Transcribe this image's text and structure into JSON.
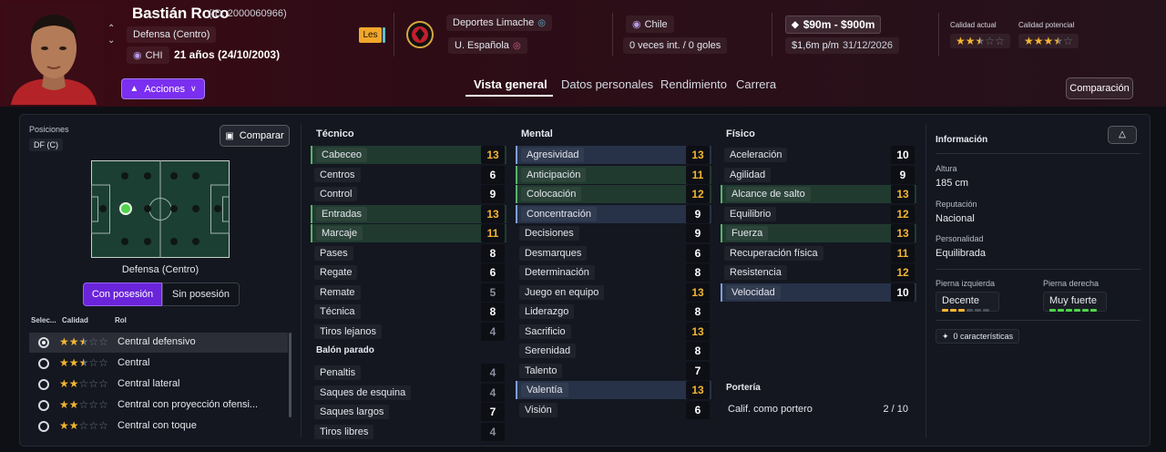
{
  "player": {
    "name": "Bastián Roco",
    "id_text": "(ID: 2000060966)",
    "position": "Defensa (Centro)",
    "nationality_code": "CHI",
    "age_text": "21 años (24/10/2003)",
    "injury_badge": "Les",
    "club": "Deportes Limache",
    "league": "U. Española",
    "country": "Chile",
    "caps_goals": "0 veces int. / 0 goles",
    "value": "$90m - $900m",
    "wage": "$1,6m p/m",
    "contract_end": "31/12/2026",
    "actions_label": "Acciones",
    "current_quality_label": "Calidad actual",
    "potential_quality_label": "Calidad potencial",
    "current_quality_stars": 2.5,
    "potential_quality_stars": 3.5
  },
  "tabs": [
    {
      "label": "Vista general",
      "active": true
    },
    {
      "label": "Datos personales",
      "active": false
    },
    {
      "label": "Rendimiento",
      "active": false
    },
    {
      "label": "Carrera",
      "active": false
    }
  ],
  "compare_top_label": "Comparación",
  "left_panel": {
    "positions_label": "Posiciones",
    "position_chip": "DF (C)",
    "compare_label": "Comparar",
    "pitch_caption": "Defensa (Centro)",
    "toggle_on": "Con posesión",
    "toggle_off": "Sin posesión",
    "col_select": "Selec...",
    "col_quality": "Calidad",
    "col_role": "Rol",
    "roles": [
      {
        "name": "Central defensivo",
        "stars": 2.5,
        "selected": true
      },
      {
        "name": "Central",
        "stars": 2.5,
        "selected": false
      },
      {
        "name": "Central lateral",
        "stars": 2,
        "selected": false
      },
      {
        "name": "Central con proyección ofensi...",
        "stars": 2,
        "selected": false
      },
      {
        "name": "Central con toque",
        "stars": 2,
        "selected": false
      }
    ]
  },
  "attributes": {
    "tecnico_title": "Técnico",
    "tecnico": [
      {
        "name": "Cabeceo",
        "value": "13",
        "hl": "g",
        "color": "y"
      },
      {
        "name": "Centros",
        "value": "6",
        "hl": "",
        "color": "w"
      },
      {
        "name": "Control",
        "value": "9",
        "hl": "",
        "color": "w"
      },
      {
        "name": "Entradas",
        "value": "13",
        "hl": "g",
        "color": "y"
      },
      {
        "name": "Marcaje",
        "value": "11",
        "hl": "g",
        "color": "y"
      },
      {
        "name": "Pases",
        "value": "8",
        "hl": "",
        "color": "w"
      },
      {
        "name": "Regate",
        "value": "6",
        "hl": "",
        "color": "w"
      },
      {
        "name": "Remate",
        "value": "5",
        "hl": "",
        "color": "g"
      },
      {
        "name": "Técnica",
        "value": "8",
        "hl": "",
        "color": "w"
      },
      {
        "name": "Tiros lejanos",
        "value": "4",
        "hl": "",
        "color": "g"
      }
    ],
    "balon_title": "Balón parado",
    "balon": [
      {
        "name": "Penaltis",
        "value": "4",
        "hl": "",
        "color": "g"
      },
      {
        "name": "Saques de esquina",
        "value": "4",
        "hl": "",
        "color": "g"
      },
      {
        "name": "Saques largos",
        "value": "7",
        "hl": "",
        "color": "w"
      },
      {
        "name": "Tiros libres",
        "value": "4",
        "hl": "",
        "color": "g"
      }
    ],
    "mental_title": "Mental",
    "mental": [
      {
        "name": "Agresividad",
        "value": "13",
        "hl": "b",
        "color": "y"
      },
      {
        "name": "Anticipación",
        "value": "11",
        "hl": "g",
        "color": "y"
      },
      {
        "name": "Colocación",
        "value": "12",
        "hl": "g",
        "color": "y"
      },
      {
        "name": "Concentración",
        "value": "9",
        "hl": "b",
        "color": "w"
      },
      {
        "name": "Decisiones",
        "value": "9",
        "hl": "",
        "color": "w"
      },
      {
        "name": "Desmarques",
        "value": "6",
        "hl": "",
        "color": "w"
      },
      {
        "name": "Determinación",
        "value": "8",
        "hl": "",
        "color": "w"
      },
      {
        "name": "Juego en equipo",
        "value": "13",
        "hl": "",
        "color": "y"
      },
      {
        "name": "Liderazgo",
        "value": "8",
        "hl": "",
        "color": "w"
      },
      {
        "name": "Sacrificio",
        "value": "13",
        "hl": "",
        "color": "y"
      },
      {
        "name": "Serenidad",
        "value": "8",
        "hl": "",
        "color": "w"
      },
      {
        "name": "Talento",
        "value": "7",
        "hl": "",
        "color": "w"
      },
      {
        "name": "Valentía",
        "value": "13",
        "hl": "b",
        "color": "y"
      },
      {
        "name": "Visión",
        "value": "6",
        "hl": "",
        "color": "w"
      }
    ],
    "fisico_title": "Físico",
    "fisico": [
      {
        "name": "Aceleración",
        "value": "10",
        "hl": "",
        "color": "w"
      },
      {
        "name": "Agilidad",
        "value": "9",
        "hl": "",
        "color": "w"
      },
      {
        "name": "Alcance de salto",
        "value": "13",
        "hl": "g",
        "color": "y"
      },
      {
        "name": "Equilibrio",
        "value": "12",
        "hl": "",
        "color": "y"
      },
      {
        "name": "Fuerza",
        "value": "13",
        "hl": "g",
        "color": "y"
      },
      {
        "name": "Recuperación física",
        "value": "11",
        "hl": "",
        "color": "y"
      },
      {
        "name": "Resistencia",
        "value": "12",
        "hl": "",
        "color": "y"
      },
      {
        "name": "Velocidad",
        "value": "10",
        "hl": "b",
        "color": "w"
      }
    ],
    "porteria_title": "Portería",
    "porteria_label": "Calif. como portero",
    "porteria_value": "2 / 10"
  },
  "info": {
    "title": "Información",
    "height_label": "Altura",
    "height": "185 cm",
    "reputation_label": "Reputación",
    "reputation": "Nacional",
    "personality_label": "Personalidad",
    "personality": "Equilibrada",
    "left_foot_label": "Pierna izquierda",
    "left_foot": "Decente",
    "left_foot_level": 3,
    "right_foot_label": "Pierna derecha",
    "right_foot": "Muy fuerte",
    "right_foot_level": 6,
    "traits_label": "0 características"
  },
  "colors": {
    "accent_purple": "#7b2ff0",
    "value_yellow": "#f3b533",
    "highlight_green": "#58b26d",
    "highlight_blue": "#7f9ed8"
  }
}
